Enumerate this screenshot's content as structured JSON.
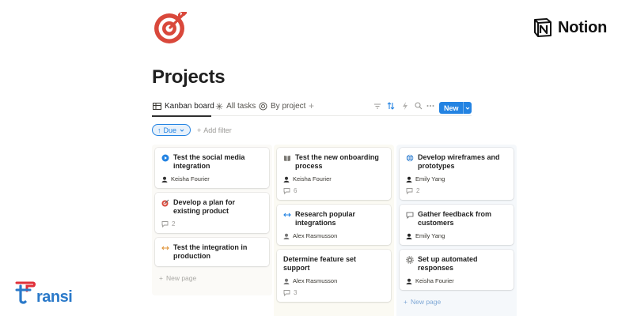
{
  "brand": {
    "notion_label": "Notion",
    "transi_label": "ransi"
  },
  "page": {
    "title": "Projects"
  },
  "tabs": [
    {
      "label": "Kanban board",
      "icon": "table-icon"
    },
    {
      "label": "All tasks",
      "icon": "asterisk-icon"
    },
    {
      "label": "By project",
      "icon": "target-icon"
    }
  ],
  "toolbar": {
    "new_label": "New",
    "icons": [
      "filter-icon",
      "sort-icon",
      "lightning-icon",
      "search-icon",
      "more-icon"
    ]
  },
  "filters": {
    "due_label": "Due",
    "add_filter_label": "Add filter"
  },
  "columns": [
    {
      "cards": [
        {
          "title": "Test the social media integration",
          "assignee": "Keisha Fourier",
          "comments": ""
        },
        {
          "title": "Develop a plan for existing product",
          "assignee": "",
          "comments": "2"
        },
        {
          "title": "Test the integration in production",
          "assignee": "",
          "comments": ""
        }
      ],
      "new_page_label": "New page"
    },
    {
      "cards": [
        {
          "title": "Test the new onboarding process",
          "assignee": "Keisha Fourier",
          "comments": "6"
        },
        {
          "title": "Research popular integrations",
          "assignee": "Alex Rasmusson",
          "comments": ""
        },
        {
          "title": "Determine feature set support",
          "assignee": "Alex Rasmusson",
          "comments": "3"
        }
      ]
    },
    {
      "cards": [
        {
          "title": "Develop wireframes and prototypes",
          "assignee": "Emily Yang",
          "comments": "2"
        },
        {
          "title": "Gather feedback from customers",
          "assignee": "Emily Yang",
          "comments": ""
        },
        {
          "title": "Set up automated responses",
          "assignee": "Keisha Fourier",
          "comments": ""
        }
      ],
      "new_page_label": "New page"
    }
  ],
  "colors": {
    "accent": "#2383e2",
    "title": "#1f1f1f",
    "muted": "#9b9a97",
    "logo_red": "#d9483b",
    "transi_blue": "#2a79c9",
    "transi_red": "#e0303a"
  }
}
